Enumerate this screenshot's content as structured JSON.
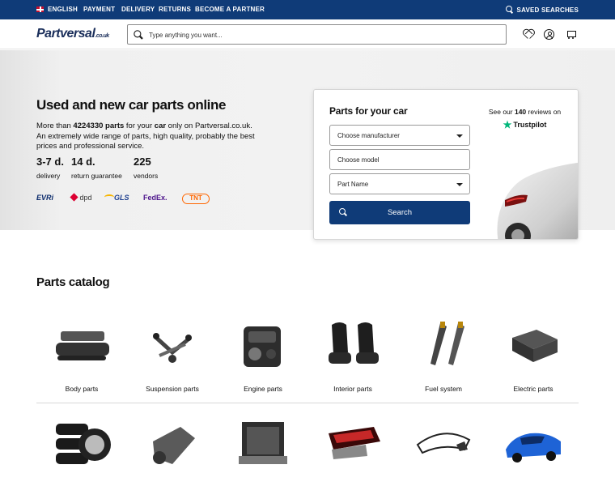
{
  "topbar": {
    "language": "ENGLISH",
    "links": [
      "PAYMENT",
      "DELIVERY",
      "RETURNS",
      "BECOME A PARTNER"
    ],
    "saved_searches": "SAVED SEARCHES"
  },
  "header": {
    "logo": "Partversal",
    "logo_suffix": ".co.uk",
    "search_placeholder": "Type anything you want..."
  },
  "hero": {
    "title": "Used and new car parts online",
    "text_pre": "More than ",
    "parts_count": "4224330 parts",
    "text_mid": " for your ",
    "car_word": "car",
    "text_post": " only on Partversal.co.uk. An extremely wide range of parts, high quality, probably the best prices and professional service.",
    "stats": [
      {
        "value": "3-7 d.",
        "label": "delivery"
      },
      {
        "value": "14 d.",
        "label": "return guarantee"
      },
      {
        "value": "225",
        "label": "vendors"
      }
    ],
    "carriers": [
      "EVRi",
      "dpd",
      "GLS",
      "FedEx.",
      "TNT"
    ]
  },
  "finder": {
    "title": "Parts for your car",
    "manufacturer": "Choose manufacturer",
    "model": "Choose model",
    "part_name": "Part Name",
    "search_label": "Search",
    "reviews_pre": "See our ",
    "reviews_count": "140",
    "reviews_post": " reviews on",
    "trustpilot": "Trustpilot"
  },
  "catalog": {
    "title": "Parts catalog",
    "items": [
      {
        "label": "Body parts"
      },
      {
        "label": "Suspension parts"
      },
      {
        "label": "Engine parts"
      },
      {
        "label": "Interior parts"
      },
      {
        "label": "Fuel system"
      },
      {
        "label": "Electric parts"
      }
    ],
    "row2_icons": [
      "tyres-icon",
      "gearbox-icon",
      "radiator-icon",
      "tail-light-icon",
      "windshield-icon",
      "car-body-icon"
    ]
  },
  "colors": {
    "brand": "#0f3b78",
    "trustpilot": "#00b67a"
  }
}
